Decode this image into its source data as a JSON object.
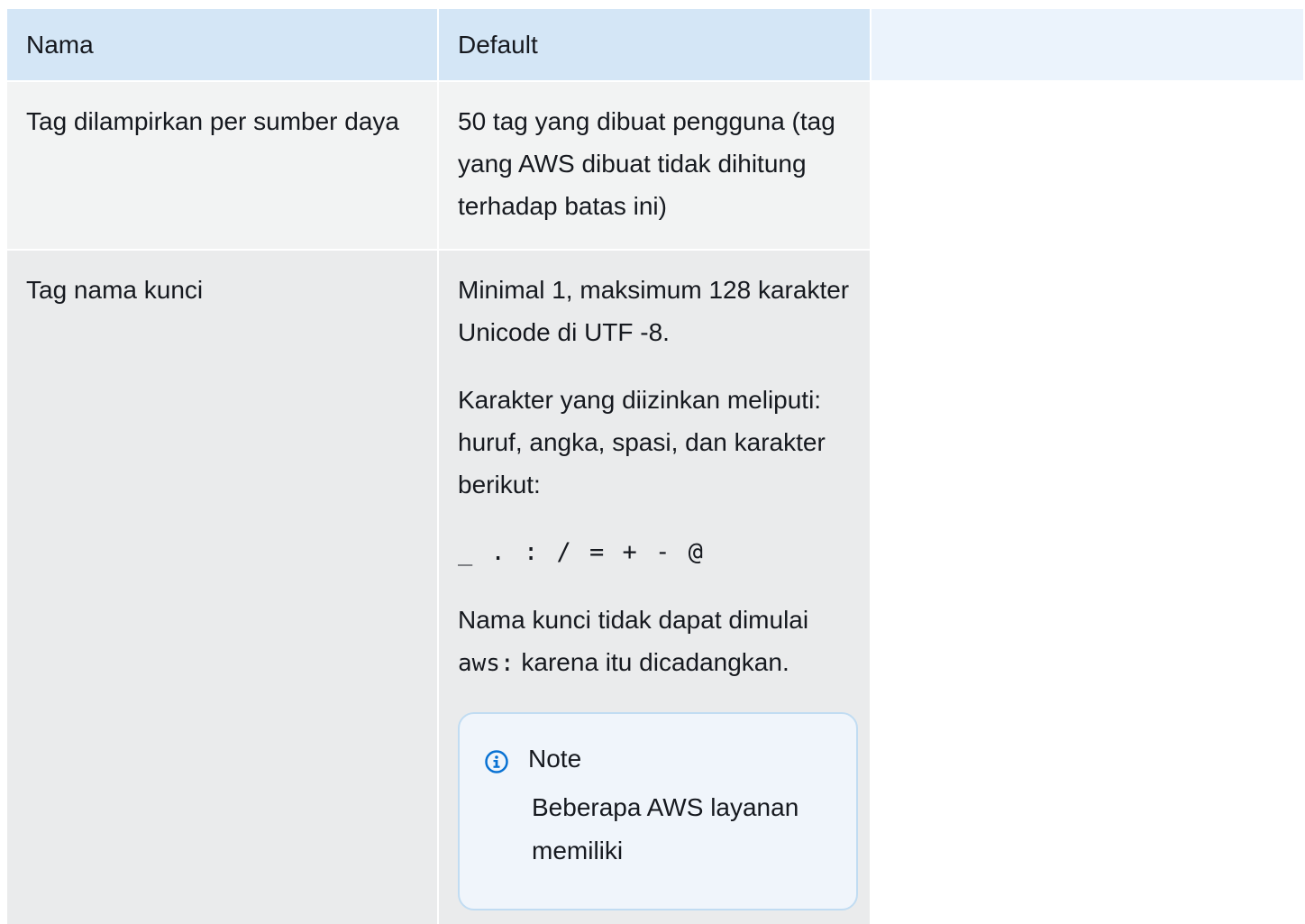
{
  "table": {
    "headers": [
      "Nama",
      "Default"
    ],
    "rows": [
      {
        "name": "Tag dilampirkan per sumber daya",
        "default_text": "50 tag yang dibuat pengguna (tag yang AWS dibuat tidak dihitung terhadap batas ini)"
      },
      {
        "name": "Tag nama kunci",
        "default_p1": "Minimal 1, maksimum 128 karakter Unicode di UTF -8.",
        "default_p2": "Karakter yang diizinkan meliputi: huruf, angka, spasi, dan karakter berikut:",
        "allowed_chars": "_ . : / = + - @",
        "default_p3_before": "Nama kunci tidak dapat dimulai",
        "default_p3_code": "aws:",
        "default_p3_after": "karena itu dicadangkan.",
        "note": {
          "icon": "info-icon",
          "title": "Note",
          "text": "Beberapa AWS layanan memiliki"
        }
      }
    ]
  },
  "colors": {
    "header_bg": "#d4e6f6",
    "header_blank_bg": "#ebf3fc",
    "row_bg_1": "#f2f3f3",
    "row_bg_2": "#eaebec",
    "note_border": "#c1dcf2",
    "info_icon": "#0972d3"
  }
}
